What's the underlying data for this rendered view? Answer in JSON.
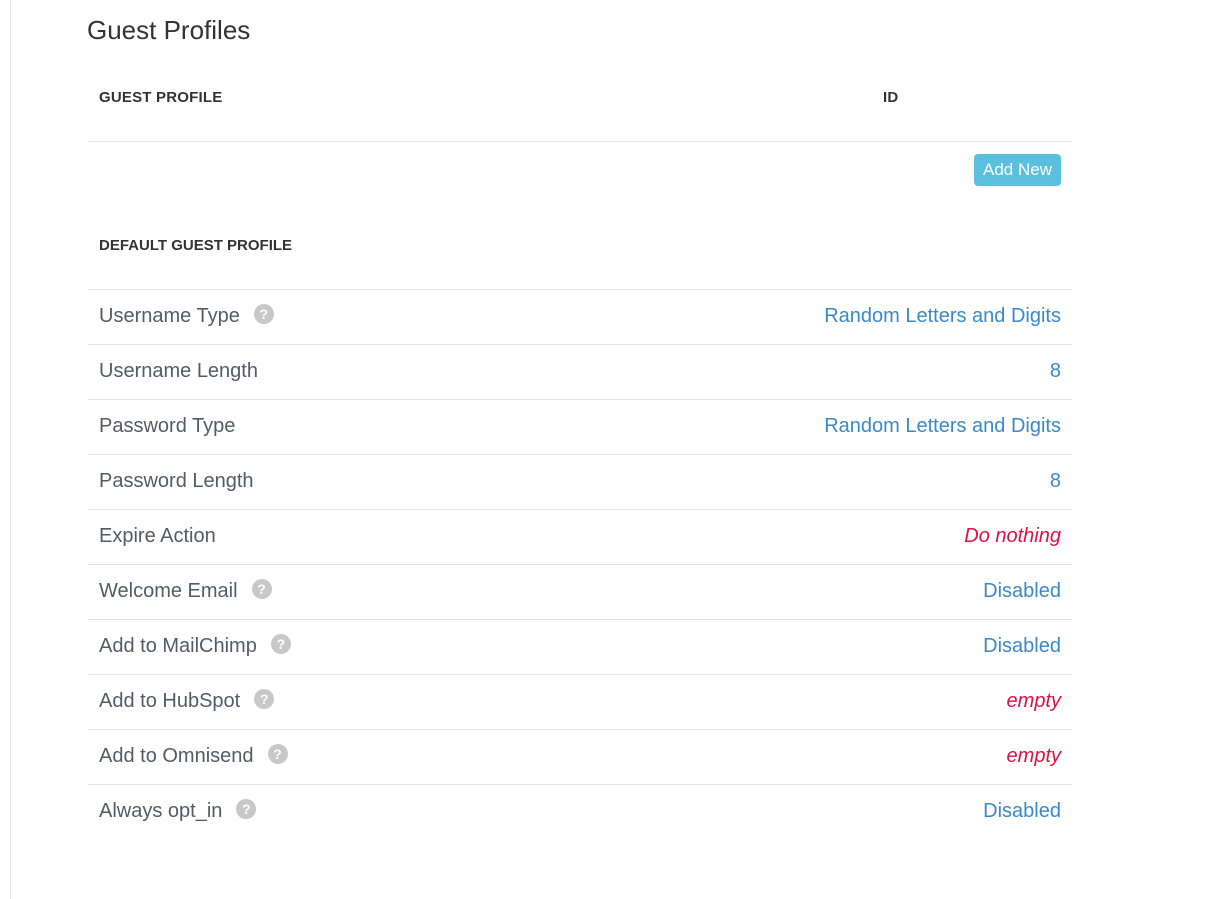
{
  "page": {
    "title": "Guest Profiles"
  },
  "table": {
    "headers": {
      "guest_profile": "GUEST PROFILE",
      "id": "ID"
    },
    "add_new_label": "Add New"
  },
  "default_profile": {
    "section_title": "DEFAULT GUEST PROFILE",
    "settings": [
      {
        "label": "Username Type",
        "value": "Random Letters and Digits",
        "help": true,
        "empty": false
      },
      {
        "label": "Username Length",
        "value": "8",
        "help": false,
        "empty": false
      },
      {
        "label": "Password Type",
        "value": "Random Letters and Digits",
        "help": false,
        "empty": false
      },
      {
        "label": "Password Length",
        "value": "8",
        "help": false,
        "empty": false
      },
      {
        "label": "Expire Action",
        "value": "Do nothing",
        "help": false,
        "empty": true
      },
      {
        "label": "Welcome Email",
        "value": "Disabled",
        "help": true,
        "empty": false
      },
      {
        "label": "Add to MailChimp",
        "value": "Disabled",
        "help": true,
        "empty": false
      },
      {
        "label": "Add to HubSpot",
        "value": "empty",
        "help": true,
        "empty": true
      },
      {
        "label": "Add to Omnisend",
        "value": "empty",
        "help": true,
        "empty": true
      },
      {
        "label": "Always opt_in",
        "value": "Disabled",
        "help": true,
        "empty": false
      }
    ]
  },
  "icons": {
    "help": "question-circle-icon",
    "help_glyph": "?"
  },
  "colors": {
    "link": "#3a89c9",
    "empty": "#dd1144",
    "button": "#5bc0de"
  }
}
